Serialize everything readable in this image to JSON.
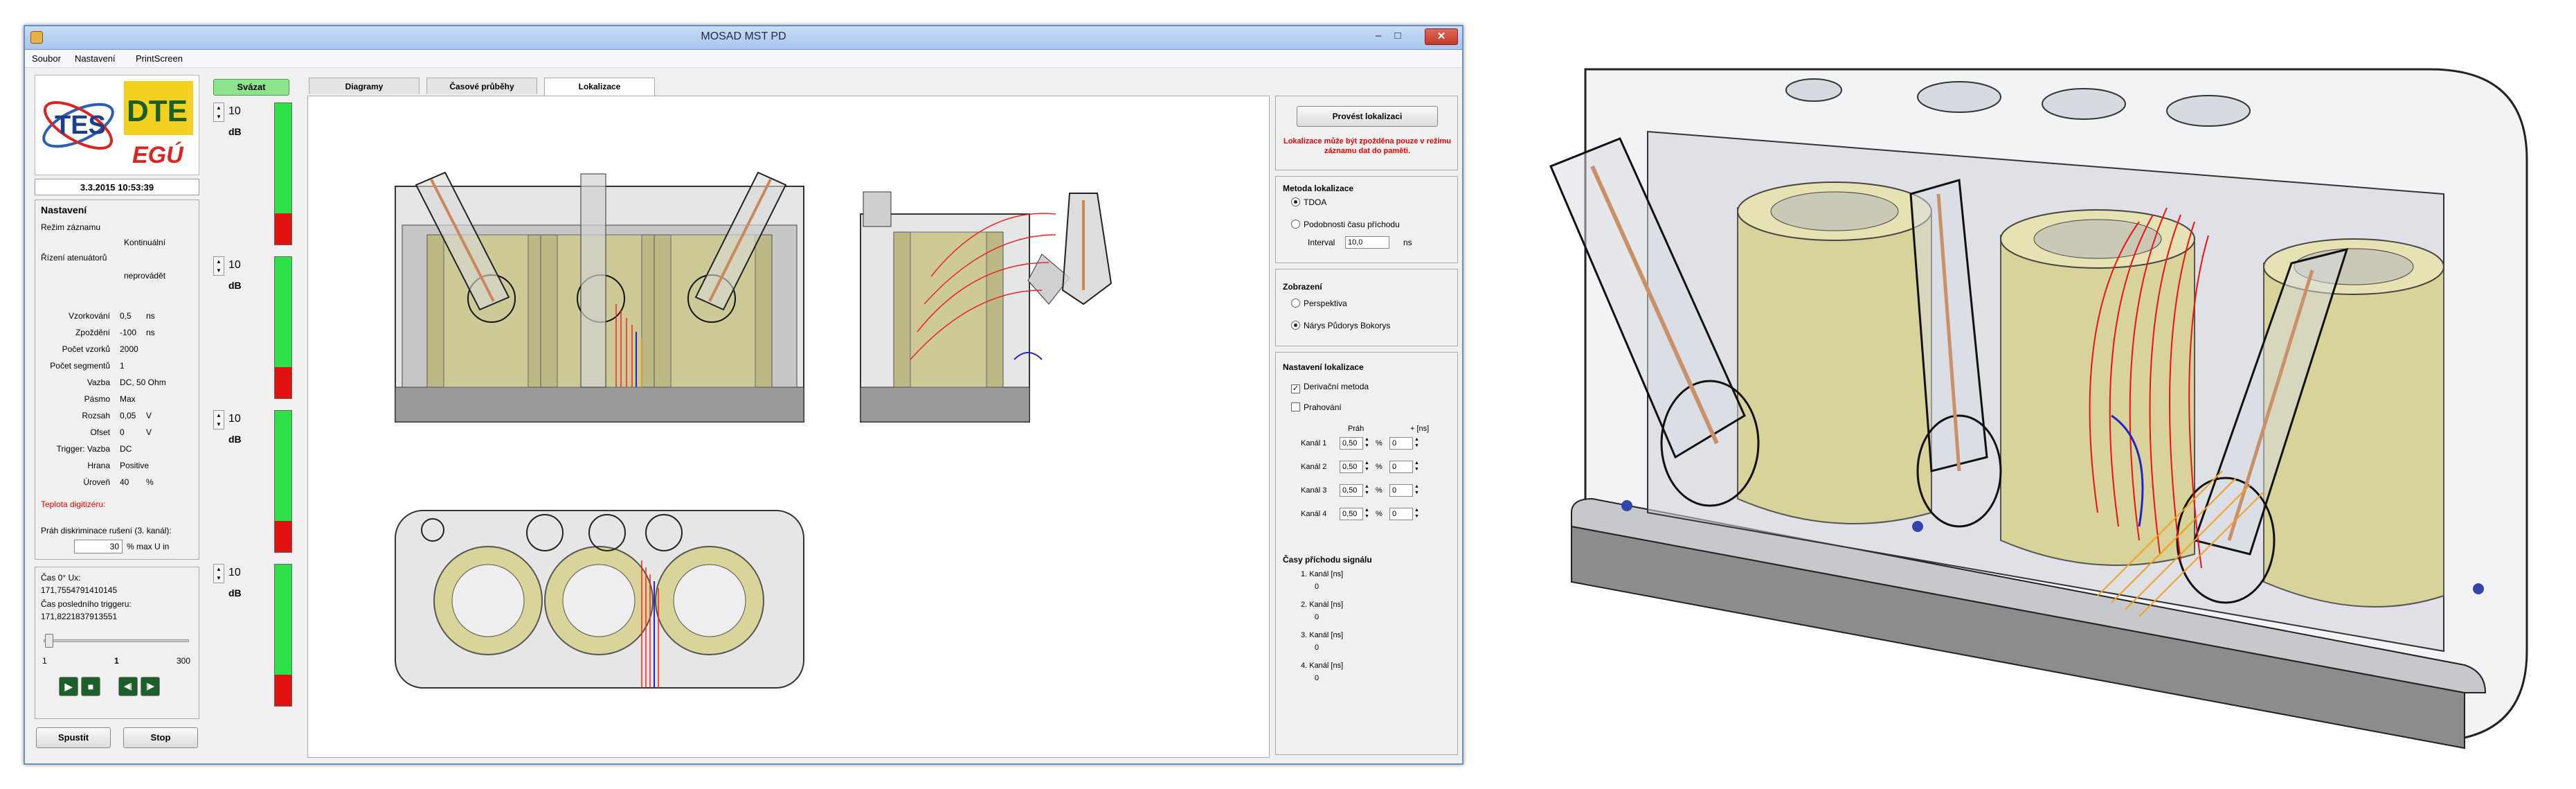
{
  "window": {
    "title": "MOSAD MST PD",
    "btn_min": "–",
    "btn_max": "□",
    "btn_close": "✕"
  },
  "menu": [
    "Soubor",
    "Nastavení",
    "PrintScreen"
  ],
  "logo": {
    "tes": "TES",
    "dte": "DTE",
    "egu": "EGÚ"
  },
  "datetime": "3.3.2015 10:53:39",
  "settings": {
    "title": "Nastavení",
    "rezim_label": "Režim záznamu",
    "rezim_value": "Kontinuální",
    "rizeni_label": "Řízení atenuátorů",
    "rizeni_value": "neprovádět",
    "rows": [
      {
        "label": "Vzorkování",
        "value": "0,5",
        "unit": "ns"
      },
      {
        "label": "Zpoždění",
        "value": "-100",
        "unit": "ns"
      },
      {
        "label": "Počet vzorků",
        "value": "2000",
        "unit": ""
      },
      {
        "label": "Počet segmentů",
        "value": "1",
        "unit": ""
      },
      {
        "label": "Vazba",
        "value": "DC, 50 Ohm",
        "unit": ""
      },
      {
        "label": "Pásmo",
        "value": "Max",
        "unit": ""
      },
      {
        "label": "Rozsah",
        "value": "0,05",
        "unit": "V"
      },
      {
        "label": "Ofset",
        "value": "0",
        "unit": "V"
      },
      {
        "label": "Trigger: Vazba",
        "value": "DC",
        "unit": ""
      },
      {
        "label": "Hrana",
        "value": "Positive",
        "unit": ""
      },
      {
        "label": "Úroveň",
        "value": "40",
        "unit": "%"
      }
    ],
    "teplota_label": "Teplota digitizéru:",
    "prah_label": "Práh diskriminace rušení (3. kanál):",
    "prah_value": "30",
    "prah_unit": "% max U in"
  },
  "time": {
    "cas_label": "Čas 0° Ux:",
    "cas_value": "171,7554791410145",
    "trigger_label": "Čas posledního triggeru:",
    "trigger_value": "171,8221837913551",
    "slider_min": "1",
    "slider_cur": "1",
    "slider_max": "300",
    "play_icon": "▶",
    "stop_icon": "■",
    "prev_icon": "◀|",
    "next_icon": "|▶",
    "start_label": "Spustit",
    "stop_label": "Stop"
  },
  "channels": {
    "svazat_label": "Svázat",
    "items": [
      {
        "value": "10",
        "unit": "dB",
        "level": 0.78
      },
      {
        "value": "10",
        "unit": "dB",
        "level": 0.78
      },
      {
        "value": "10",
        "unit": "dB",
        "level": 0.78
      },
      {
        "value": "10",
        "unit": "dB",
        "level": 0.78
      }
    ]
  },
  "tabs": [
    "Diagramy",
    "Časové průběhy",
    "Lokalizace"
  ],
  "right": {
    "provest_label": "Provést lokalizaci",
    "warning": "Lokalizace může být zpožděna pouze v režimu záznamu dat do paměti.",
    "metoda_title": "Metoda lokalizace",
    "metoda_tdoa": "TDOA",
    "metoda_podob": "Podobnosti času příchodu",
    "interval_label": "Interval",
    "interval_value": "10,0",
    "interval_unit": "ns",
    "zobraz_title": "Zobrazení",
    "zobraz_persp": "Perspektiva",
    "zobraz_narys": "Nárys Půdorys Bokorys",
    "nast_title": "Nastavení lokalizace",
    "derivacni": "Derivační metoda",
    "prahovani": "Prahování",
    "col_prah": "Práh",
    "col_shift": "+ [ns]",
    "pct": "%",
    "kanaly": [
      {
        "label": "Kanál 1",
        "prah": "0,50",
        "shift": "0"
      },
      {
        "label": "Kanál 2",
        "prah": "0,50",
        "shift": "0"
      },
      {
        "label": "Kanál 3",
        "prah": "0,50",
        "shift": "0"
      },
      {
        "label": "Kanál 4",
        "prah": "0,50",
        "shift": "0"
      }
    ],
    "casy_title": "Časy příchodu signálu",
    "casy": [
      {
        "label": "1. Kanál [ns]",
        "value": "0"
      },
      {
        "label": "2. Kanál [ns]",
        "value": "0"
      },
      {
        "label": "3. Kanál [ns]",
        "value": "0"
      },
      {
        "label": "4. Kanál [ns]",
        "value": "0"
      }
    ]
  },
  "colors": {
    "accent_green": "#2ee04a",
    "meter_red": "#e01111",
    "warning_red": "#e00000",
    "coil_yellow": "#d9d59a"
  }
}
